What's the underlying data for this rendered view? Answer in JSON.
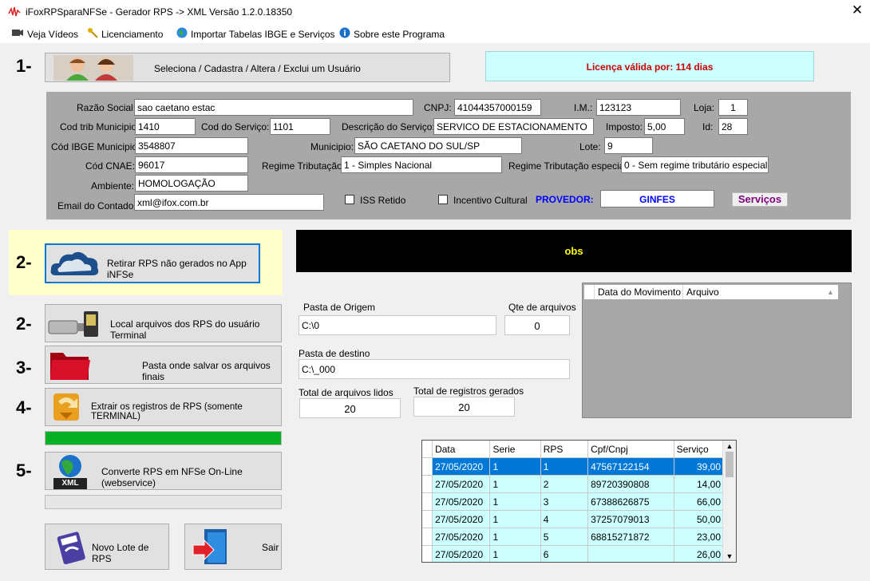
{
  "window": {
    "title": "iFoxRPSparaNFSe - Gerador RPS -> XML Versão 1.2.0.18350",
    "close": "✕"
  },
  "menu": [
    {
      "label": "Veja Vídeos"
    },
    {
      "label": "Licenciamento"
    },
    {
      "label": "Importar Tabelas IBGE e Serviços"
    },
    {
      "label": "Sobre este Programa"
    }
  ],
  "steps": {
    "s1": "1-",
    "s2a": "2-",
    "s2b": "2-",
    "s3": "3-",
    "s4": "4-",
    "s5": "5-"
  },
  "user_button": "Seleciona / Cadastra / Altera / Exclui um Usuário",
  "license": "Licença válida por: 114 dias",
  "form": {
    "razao_social": {
      "label": "Razão Social:",
      "value": "sao caetano estac"
    },
    "cnpj": {
      "label": "CNPJ:",
      "value": "41044357000159"
    },
    "im": {
      "label": "I.M.:",
      "value": "123123"
    },
    "loja": {
      "label": "Loja:",
      "value": "1"
    },
    "cod_trib": {
      "label": "Cod trib Municipio:",
      "value": "1410"
    },
    "cod_servico": {
      "label": "Cod do Serviço:",
      "value": "1101"
    },
    "descricao": {
      "label": "Descrição do Serviço:",
      "value": "SERVICO DE ESTACIONAMENTO"
    },
    "imposto": {
      "label": "Imposto:",
      "value": "5,00"
    },
    "id": {
      "label": "Id:",
      "value": "28"
    },
    "ibge": {
      "label": "Cód IBGE Municipio:",
      "value": "3548807"
    },
    "municipio": {
      "label": "Municipio:",
      "value": "SÃO CAETANO DO SUL/SP"
    },
    "lote": {
      "label": "Lote:",
      "value": "9"
    },
    "cnae": {
      "label": "Cód CNAE:",
      "value": "96017"
    },
    "regime": {
      "label": "Regime Tributação:",
      "value": "1 - Simples Nacional"
    },
    "regime_esp": {
      "label": "Regime Tributação especial:",
      "value": "0 - Sem regime tributário especial"
    },
    "ambiente": {
      "label": "Ambiente:",
      "value": "HOMOLOGAÇÃO"
    },
    "email": {
      "label": "Email do Contador:",
      "value": "xml@ifox.com.br"
    },
    "iss_retido": "ISS Retido",
    "incentivo": "Incentivo Cultural",
    "provedor_label": "PROVEDOR:",
    "provedor_value": "GINFES",
    "servicos": "Serviços"
  },
  "buttons": {
    "retirar": "Retirar RPS não gerados no App iNFSe",
    "local": "Local arquivos dos RPS do usuário Terminal",
    "pasta": "Pasta onde salvar os arquivos finais",
    "extrair": "Extrair os registros de RPS (somente TERMINAL)",
    "converte": "Converte RPS em NFSe On-Line (webservice)",
    "xml_badge": "XML",
    "novo_lote": "Novo Lote de RPS",
    "sair": "Sair"
  },
  "progress_extract": 1.0,
  "obs": "obs",
  "origem": {
    "label": "Pasta de Origem",
    "value": "C:\\0"
  },
  "qte": {
    "label": "Qte de arquivos",
    "value": "0"
  },
  "destino": {
    "label": "Pasta de destino",
    "value": "C:\\_000"
  },
  "lidos": {
    "label": "Total de arquivos lidos",
    "value": "20"
  },
  "gerados": {
    "label": "Total de registros gerados",
    "value": "20"
  },
  "movimento_headers": [
    "Data do Movimento",
    "Arquivo"
  ],
  "grid": {
    "headers": [
      "Data",
      "Serie",
      "RPS",
      "Cpf/Cnpj",
      "Serviço"
    ],
    "rows": [
      [
        "27/05/2020",
        "1",
        "1",
        "47567122154",
        "39,00"
      ],
      [
        "27/05/2020",
        "1",
        "2",
        "89720390808",
        "14,00"
      ],
      [
        "27/05/2020",
        "1",
        "3",
        "67388626875",
        "66,00"
      ],
      [
        "27/05/2020",
        "1",
        "4",
        "37257079013",
        "50,00"
      ],
      [
        "27/05/2020",
        "1",
        "5",
        "68815271872",
        "23,00"
      ],
      [
        "27/05/2020",
        "1",
        "6",
        "",
        "26,00"
      ]
    ]
  },
  "colors": {
    "accent": "#0078d7",
    "license_bg": "#ccffff",
    "progress": "#06b025",
    "provedor": "#0000ff",
    "license_text": "#cc0000"
  }
}
